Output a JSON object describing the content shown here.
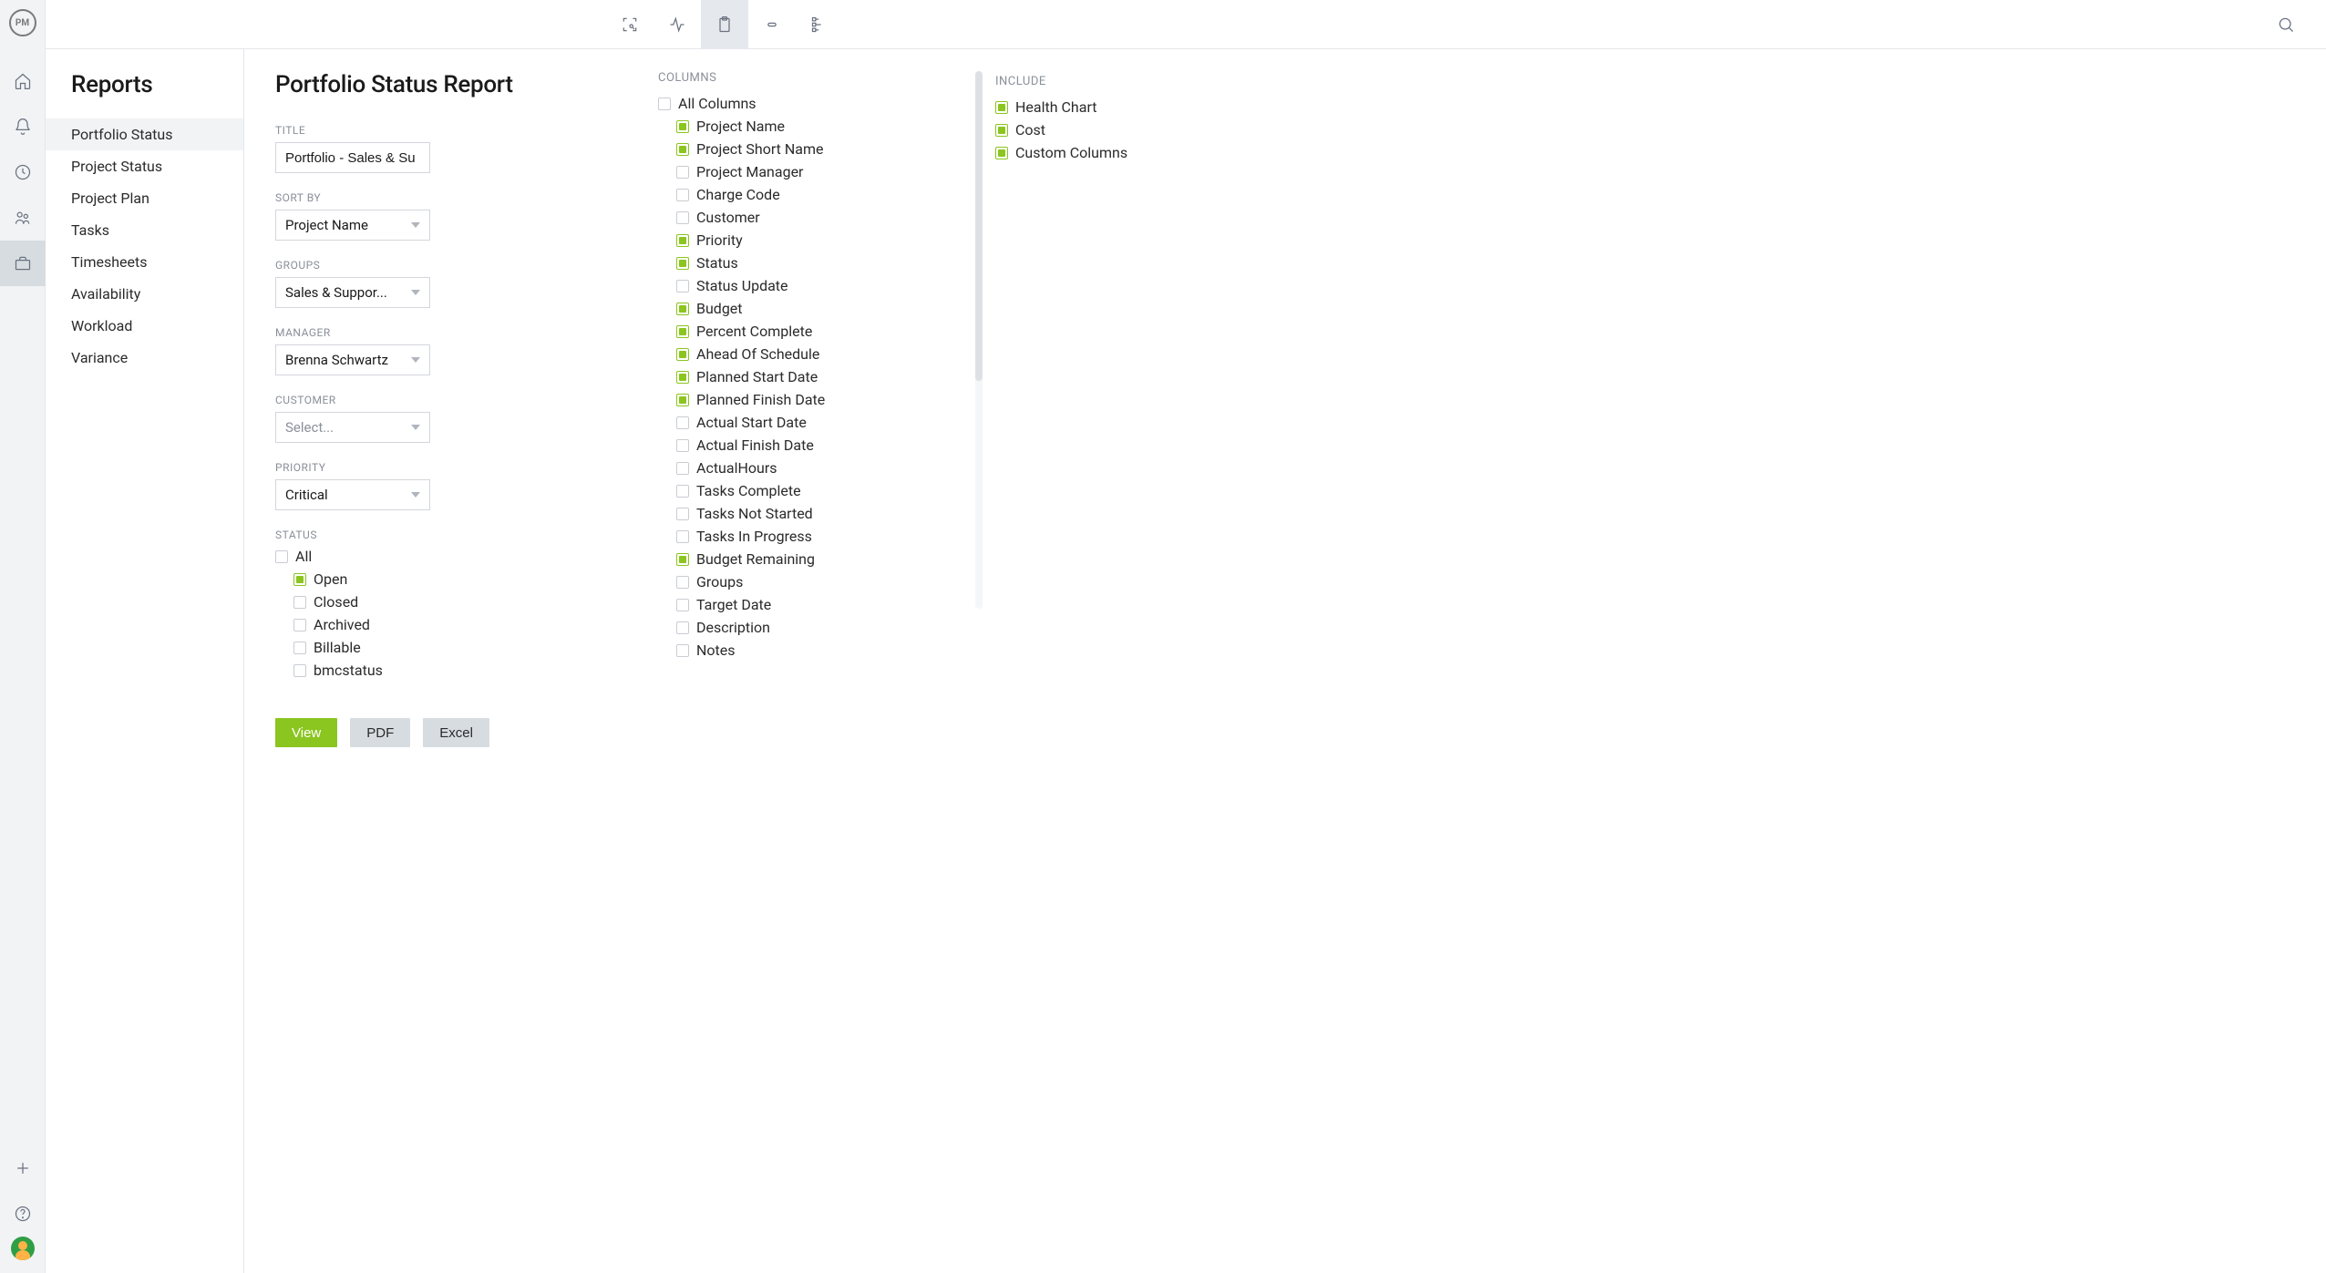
{
  "logo": "PM",
  "sidebar": {
    "title": "Reports",
    "items": [
      {
        "label": "Portfolio Status",
        "active": true
      },
      {
        "label": "Project Status"
      },
      {
        "label": "Project Plan"
      },
      {
        "label": "Tasks"
      },
      {
        "label": "Timesheets"
      },
      {
        "label": "Availability"
      },
      {
        "label": "Workload"
      },
      {
        "label": "Variance"
      }
    ]
  },
  "page": {
    "title": "Portfolio Status Report"
  },
  "form": {
    "title_label": "TITLE",
    "title_value": "Portfolio - Sales & Su",
    "sortby_label": "SORT BY",
    "sortby_value": "Project Name",
    "groups_label": "GROUPS",
    "groups_value": "Sales & Suppor...",
    "manager_label": "MANAGER",
    "manager_value": "Brenna Schwartz",
    "customer_label": "CUSTOMER",
    "customer_placeholder": "Select...",
    "priority_label": "PRIORITY",
    "priority_value": "Critical",
    "status_label": "STATUS",
    "status_items": [
      {
        "label": "All",
        "checked": false,
        "indent": false
      },
      {
        "label": "Open",
        "checked": true,
        "indent": true
      },
      {
        "label": "Closed",
        "checked": false,
        "indent": true
      },
      {
        "label": "Archived",
        "checked": false,
        "indent": true
      },
      {
        "label": "Billable",
        "checked": false,
        "indent": true
      },
      {
        "label": "bmcstatus",
        "checked": false,
        "indent": true
      }
    ]
  },
  "columns": {
    "heading": "COLUMNS",
    "items": [
      {
        "label": "All Columns",
        "checked": false,
        "indent": false
      },
      {
        "label": "Project Name",
        "checked": true,
        "indent": true
      },
      {
        "label": "Project Short Name",
        "checked": true,
        "indent": true
      },
      {
        "label": "Project Manager",
        "checked": false,
        "indent": true
      },
      {
        "label": "Charge Code",
        "checked": false,
        "indent": true
      },
      {
        "label": "Customer",
        "checked": false,
        "indent": true
      },
      {
        "label": "Priority",
        "checked": true,
        "indent": true
      },
      {
        "label": "Status",
        "checked": true,
        "indent": true
      },
      {
        "label": "Status Update",
        "checked": false,
        "indent": true
      },
      {
        "label": "Budget",
        "checked": true,
        "indent": true
      },
      {
        "label": "Percent Complete",
        "checked": true,
        "indent": true
      },
      {
        "label": "Ahead Of Schedule",
        "checked": true,
        "indent": true
      },
      {
        "label": "Planned Start Date",
        "checked": true,
        "indent": true
      },
      {
        "label": "Planned Finish Date",
        "checked": true,
        "indent": true
      },
      {
        "label": "Actual Start Date",
        "checked": false,
        "indent": true
      },
      {
        "label": "Actual Finish Date",
        "checked": false,
        "indent": true
      },
      {
        "label": "ActualHours",
        "checked": false,
        "indent": true
      },
      {
        "label": "Tasks Complete",
        "checked": false,
        "indent": true
      },
      {
        "label": "Tasks Not Started",
        "checked": false,
        "indent": true
      },
      {
        "label": "Tasks In Progress",
        "checked": false,
        "indent": true
      },
      {
        "label": "Budget Remaining",
        "checked": true,
        "indent": true
      },
      {
        "label": "Groups",
        "checked": false,
        "indent": true
      },
      {
        "label": "Target Date",
        "checked": false,
        "indent": true
      },
      {
        "label": "Description",
        "checked": false,
        "indent": true
      },
      {
        "label": "Notes",
        "checked": false,
        "indent": true
      }
    ]
  },
  "include": {
    "heading": "INCLUDE",
    "items": [
      {
        "label": "Health Chart",
        "checked": true
      },
      {
        "label": "Cost",
        "checked": true
      },
      {
        "label": "Custom Columns",
        "checked": true
      }
    ]
  },
  "buttons": {
    "view": "View",
    "pdf": "PDF",
    "excel": "Excel"
  }
}
